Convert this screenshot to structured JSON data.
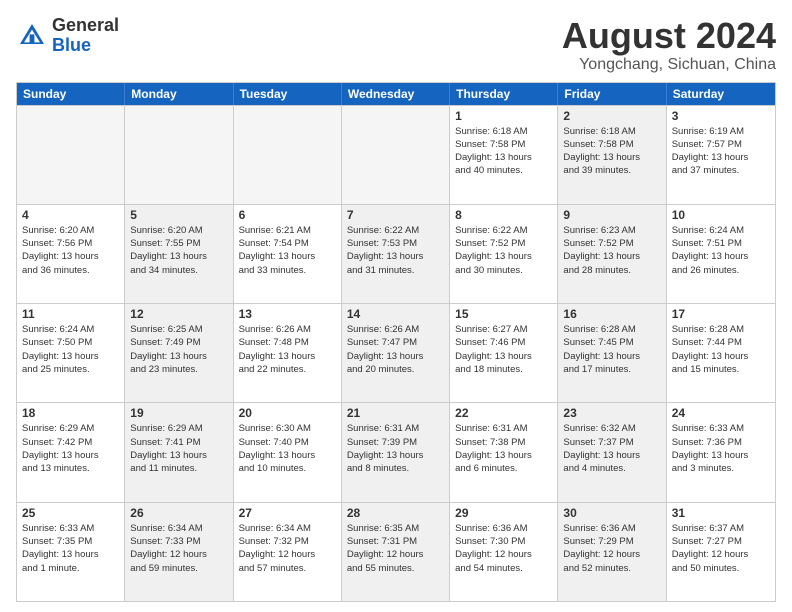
{
  "header": {
    "logo_general": "General",
    "logo_blue": "Blue",
    "month_year": "August 2024",
    "location": "Yongchang, Sichuan, China"
  },
  "weekdays": [
    "Sunday",
    "Monday",
    "Tuesday",
    "Wednesday",
    "Thursday",
    "Friday",
    "Saturday"
  ],
  "rows": [
    [
      {
        "day": "",
        "info": "",
        "empty": true
      },
      {
        "day": "",
        "info": "",
        "empty": true
      },
      {
        "day": "",
        "info": "",
        "empty": true
      },
      {
        "day": "",
        "info": "",
        "empty": true
      },
      {
        "day": "1",
        "info": "Sunrise: 6:18 AM\nSunset: 7:58 PM\nDaylight: 13 hours\nand 40 minutes.",
        "empty": false
      },
      {
        "day": "2",
        "info": "Sunrise: 6:18 AM\nSunset: 7:58 PM\nDaylight: 13 hours\nand 39 minutes.",
        "empty": false,
        "shaded": true
      },
      {
        "day": "3",
        "info": "Sunrise: 6:19 AM\nSunset: 7:57 PM\nDaylight: 13 hours\nand 37 minutes.",
        "empty": false
      }
    ],
    [
      {
        "day": "4",
        "info": "Sunrise: 6:20 AM\nSunset: 7:56 PM\nDaylight: 13 hours\nand 36 minutes.",
        "empty": false
      },
      {
        "day": "5",
        "info": "Sunrise: 6:20 AM\nSunset: 7:55 PM\nDaylight: 13 hours\nand 34 minutes.",
        "empty": false,
        "shaded": true
      },
      {
        "day": "6",
        "info": "Sunrise: 6:21 AM\nSunset: 7:54 PM\nDaylight: 13 hours\nand 33 minutes.",
        "empty": false
      },
      {
        "day": "7",
        "info": "Sunrise: 6:22 AM\nSunset: 7:53 PM\nDaylight: 13 hours\nand 31 minutes.",
        "empty": false,
        "shaded": true
      },
      {
        "day": "8",
        "info": "Sunrise: 6:22 AM\nSunset: 7:52 PM\nDaylight: 13 hours\nand 30 minutes.",
        "empty": false
      },
      {
        "day": "9",
        "info": "Sunrise: 6:23 AM\nSunset: 7:52 PM\nDaylight: 13 hours\nand 28 minutes.",
        "empty": false,
        "shaded": true
      },
      {
        "day": "10",
        "info": "Sunrise: 6:24 AM\nSunset: 7:51 PM\nDaylight: 13 hours\nand 26 minutes.",
        "empty": false
      }
    ],
    [
      {
        "day": "11",
        "info": "Sunrise: 6:24 AM\nSunset: 7:50 PM\nDaylight: 13 hours\nand 25 minutes.",
        "empty": false
      },
      {
        "day": "12",
        "info": "Sunrise: 6:25 AM\nSunset: 7:49 PM\nDaylight: 13 hours\nand 23 minutes.",
        "empty": false,
        "shaded": true
      },
      {
        "day": "13",
        "info": "Sunrise: 6:26 AM\nSunset: 7:48 PM\nDaylight: 13 hours\nand 22 minutes.",
        "empty": false
      },
      {
        "day": "14",
        "info": "Sunrise: 6:26 AM\nSunset: 7:47 PM\nDaylight: 13 hours\nand 20 minutes.",
        "empty": false,
        "shaded": true
      },
      {
        "day": "15",
        "info": "Sunrise: 6:27 AM\nSunset: 7:46 PM\nDaylight: 13 hours\nand 18 minutes.",
        "empty": false
      },
      {
        "day": "16",
        "info": "Sunrise: 6:28 AM\nSunset: 7:45 PM\nDaylight: 13 hours\nand 17 minutes.",
        "empty": false,
        "shaded": true
      },
      {
        "day": "17",
        "info": "Sunrise: 6:28 AM\nSunset: 7:44 PM\nDaylight: 13 hours\nand 15 minutes.",
        "empty": false
      }
    ],
    [
      {
        "day": "18",
        "info": "Sunrise: 6:29 AM\nSunset: 7:42 PM\nDaylight: 13 hours\nand 13 minutes.",
        "empty": false
      },
      {
        "day": "19",
        "info": "Sunrise: 6:29 AM\nSunset: 7:41 PM\nDaylight: 13 hours\nand 11 minutes.",
        "empty": false,
        "shaded": true
      },
      {
        "day": "20",
        "info": "Sunrise: 6:30 AM\nSunset: 7:40 PM\nDaylight: 13 hours\nand 10 minutes.",
        "empty": false
      },
      {
        "day": "21",
        "info": "Sunrise: 6:31 AM\nSunset: 7:39 PM\nDaylight: 13 hours\nand 8 minutes.",
        "empty": false,
        "shaded": true
      },
      {
        "day": "22",
        "info": "Sunrise: 6:31 AM\nSunset: 7:38 PM\nDaylight: 13 hours\nand 6 minutes.",
        "empty": false
      },
      {
        "day": "23",
        "info": "Sunrise: 6:32 AM\nSunset: 7:37 PM\nDaylight: 13 hours\nand 4 minutes.",
        "empty": false,
        "shaded": true
      },
      {
        "day": "24",
        "info": "Sunrise: 6:33 AM\nSunset: 7:36 PM\nDaylight: 13 hours\nand 3 minutes.",
        "empty": false
      }
    ],
    [
      {
        "day": "25",
        "info": "Sunrise: 6:33 AM\nSunset: 7:35 PM\nDaylight: 13 hours\nand 1 minute.",
        "empty": false
      },
      {
        "day": "26",
        "info": "Sunrise: 6:34 AM\nSunset: 7:33 PM\nDaylight: 12 hours\nand 59 minutes.",
        "empty": false,
        "shaded": true
      },
      {
        "day": "27",
        "info": "Sunrise: 6:34 AM\nSunset: 7:32 PM\nDaylight: 12 hours\nand 57 minutes.",
        "empty": false
      },
      {
        "day": "28",
        "info": "Sunrise: 6:35 AM\nSunset: 7:31 PM\nDaylight: 12 hours\nand 55 minutes.",
        "empty": false,
        "shaded": true
      },
      {
        "day": "29",
        "info": "Sunrise: 6:36 AM\nSunset: 7:30 PM\nDaylight: 12 hours\nand 54 minutes.",
        "empty": false
      },
      {
        "day": "30",
        "info": "Sunrise: 6:36 AM\nSunset: 7:29 PM\nDaylight: 12 hours\nand 52 minutes.",
        "empty": false,
        "shaded": true
      },
      {
        "day": "31",
        "info": "Sunrise: 6:37 AM\nSunset: 7:27 PM\nDaylight: 12 hours\nand 50 minutes.",
        "empty": false
      }
    ]
  ]
}
